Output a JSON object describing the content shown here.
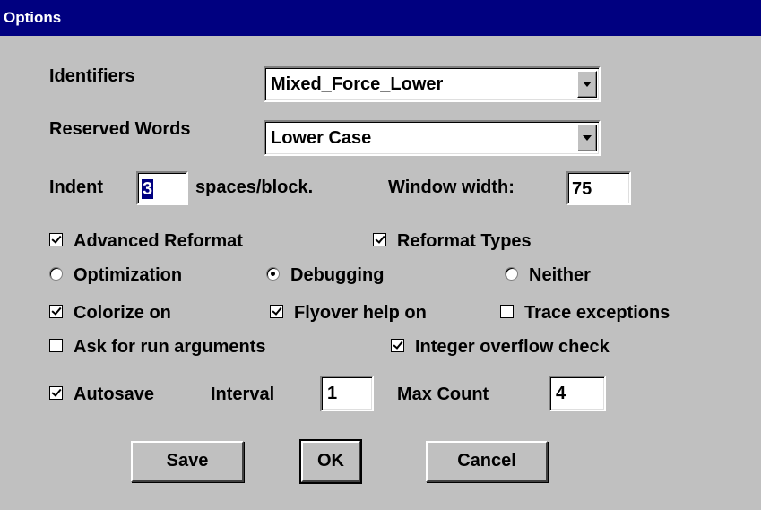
{
  "window": {
    "title": "Options"
  },
  "identifiers": {
    "label": "Identifiers",
    "value": "Mixed_Force_Lower"
  },
  "reserved_words": {
    "label": "Reserved Words",
    "value": "Lower Case"
  },
  "indent": {
    "label": "Indent",
    "value": "3",
    "suffix": "spaces/block."
  },
  "window_width": {
    "label": "Window width:",
    "value": "75"
  },
  "checks": {
    "advanced_reformat": {
      "label": "Advanced Reformat",
      "checked": true
    },
    "reformat_types": {
      "label": "Reformat Types",
      "checked": true
    },
    "colorize_on": {
      "label": "Colorize on",
      "checked": true
    },
    "flyover_help_on": {
      "label": "Flyover help on",
      "checked": true
    },
    "trace_exceptions": {
      "label": "Trace exceptions",
      "checked": false
    },
    "ask_run_args": {
      "label": "Ask for run arguments",
      "checked": false
    },
    "integer_overflow": {
      "label": "Integer overflow check",
      "checked": true
    },
    "autosave": {
      "label": "Autosave",
      "checked": true
    }
  },
  "mode": {
    "options": [
      "Optimization",
      "Debugging",
      "Neither"
    ],
    "selected": "Debugging"
  },
  "autosave": {
    "interval_label": "Interval",
    "interval_value": "1",
    "max_count_label": "Max Count",
    "max_count_value": "4"
  },
  "buttons": {
    "save": "Save",
    "ok": "OK",
    "cancel": "Cancel"
  }
}
